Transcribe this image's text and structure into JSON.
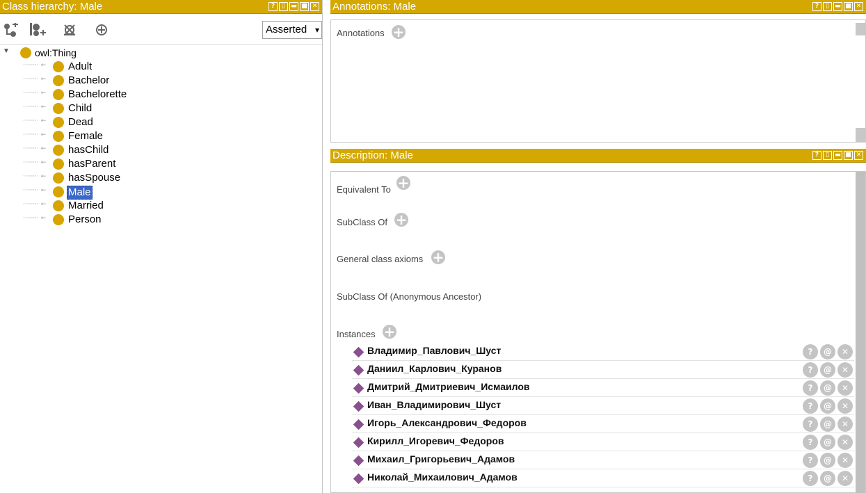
{
  "left_panel": {
    "title": "Class hierarchy: Male",
    "header_buttons": [
      "?",
      "▯",
      "▬",
      "■",
      "✕"
    ],
    "toolbar": {
      "icons": [
        "add-subclass-icon",
        "add-sibling-class-icon",
        "delete-class-icon",
        "expand-icon"
      ],
      "mode_select": "Asserted",
      "mode_caret": "▾"
    },
    "tree": {
      "root": {
        "toggle": "▼",
        "label": "owl:Thing"
      },
      "items": [
        {
          "label": "Adult"
        },
        {
          "label": "Bachelor"
        },
        {
          "label": "Bachelorette"
        },
        {
          "label": "Child"
        },
        {
          "label": "Dead"
        },
        {
          "label": "Female"
        },
        {
          "label": "hasChild"
        },
        {
          "label": "hasParent"
        },
        {
          "label": "hasSpouse"
        },
        {
          "label": "Male",
          "selected": true
        },
        {
          "label": "Married"
        },
        {
          "label": "Person"
        }
      ],
      "connector": "········ ←"
    }
  },
  "annotations_panel": {
    "title": "Annotations: Male",
    "header_buttons": [
      "?",
      "▯",
      "▬",
      "■",
      "✕"
    ],
    "section_label": "Annotations",
    "add_symbol": "+"
  },
  "description_panel": {
    "title": "Description: Male",
    "header_buttons": [
      "?",
      "▯",
      "▬",
      "■",
      "✕"
    ],
    "sections": {
      "equivalent_to": "Equivalent To",
      "subclass_of": "SubClass Of",
      "general_class_axioms": "General class axioms",
      "subclass_anon": "SubClass Of (Anonymous Ancestor)",
      "instances": "Instances"
    },
    "add_symbol": "+",
    "instances": [
      "Владимир_Павлович_Шуст",
      "Даниил_Карлович_Куранов",
      "Дмитрий_Дмитриевич_Исмаилов",
      "Иван_Владимирович_Шуст",
      "Игорь_Александрович_Федоров",
      "Кирилл_Игоревич_Федоров",
      "Михаил_Григорьевич_Адамов",
      "Николай_Михаилович_Адамов"
    ],
    "row_buttons": [
      "?",
      "@",
      "✕"
    ]
  },
  "colors": {
    "header_gold": "#d4a800",
    "class_dot": "#d6a500",
    "individual_diamond": "#8a4f8e",
    "selection_blue": "#3b67c9"
  }
}
